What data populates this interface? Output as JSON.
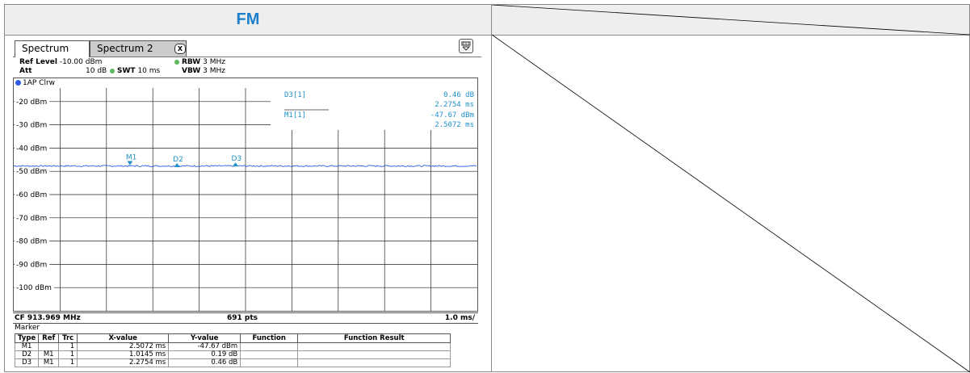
{
  "document": {
    "title": "FM"
  },
  "tabs": [
    {
      "label": "Spectrum",
      "active": true
    },
    {
      "label": "Spectrum 2",
      "active": false
    }
  ],
  "settings": {
    "ref_level_label": "Ref Level",
    "ref_level_value": "-10.00 dBm",
    "att_label": "Att",
    "att_value": "10 dB",
    "swt_label": "SWT",
    "swt_value": "10 ms",
    "rbw_label": "RBW",
    "rbw_value": "3 MHz",
    "vbw_label": "VBW",
    "vbw_value": "3 MHz"
  },
  "trace": {
    "label": "1AP Clrw",
    "color": "#2f5be0"
  },
  "marker_readout": {
    "d3_label": "D3[1]",
    "d3_value1": "0.46 dB",
    "d3_value2": "2.2754 ms",
    "m1_label": "M1[1]",
    "m1_value1": "-47.67 dBm",
    "m1_value2": "2.5072 ms",
    "color": "#1e90c8"
  },
  "chart_data": {
    "type": "line",
    "y_labels": [
      "-20 dBm",
      "-30 dBm",
      "-40 dBm",
      "-50 dBm",
      "-60 dBm",
      "-70 dBm",
      "-80 dBm",
      "-90 dBm",
      "-100 dBm"
    ],
    "ylim": [
      -110,
      -10
    ],
    "xlim": [
      0,
      10
    ],
    "x_unit": "ms",
    "grid": true,
    "series": [
      {
        "level_dbm": -47.7
      }
    ],
    "markers": [
      {
        "label": "M1",
        "x": 2.5072,
        "y": -47.67,
        "shape": "down"
      },
      {
        "label": "D2",
        "x": 3.5217,
        "y": -47.48,
        "shape": "up"
      },
      {
        "label": "D3",
        "x": 4.7826,
        "y": -47.21,
        "shape": "up"
      }
    ]
  },
  "status": {
    "cf": "CF 913.969 MHz",
    "points": "691 pts",
    "span": "1.0 ms/"
  },
  "marker_table": {
    "title": "Marker",
    "headers": [
      "Type",
      "Ref",
      "Trc",
      "X-value",
      "Y-value",
      "Function",
      "Function Result"
    ],
    "rows": [
      [
        "M1",
        "",
        "1",
        "2.5072 ms",
        "-47.67 dBm",
        "",
        ""
      ],
      [
        "D2",
        "M1",
        "1",
        "1.0145 ms",
        "0.19 dB",
        "",
        ""
      ],
      [
        "D3",
        "M1",
        "1",
        "2.2754 ms",
        "0.46 dB",
        "",
        ""
      ]
    ]
  }
}
